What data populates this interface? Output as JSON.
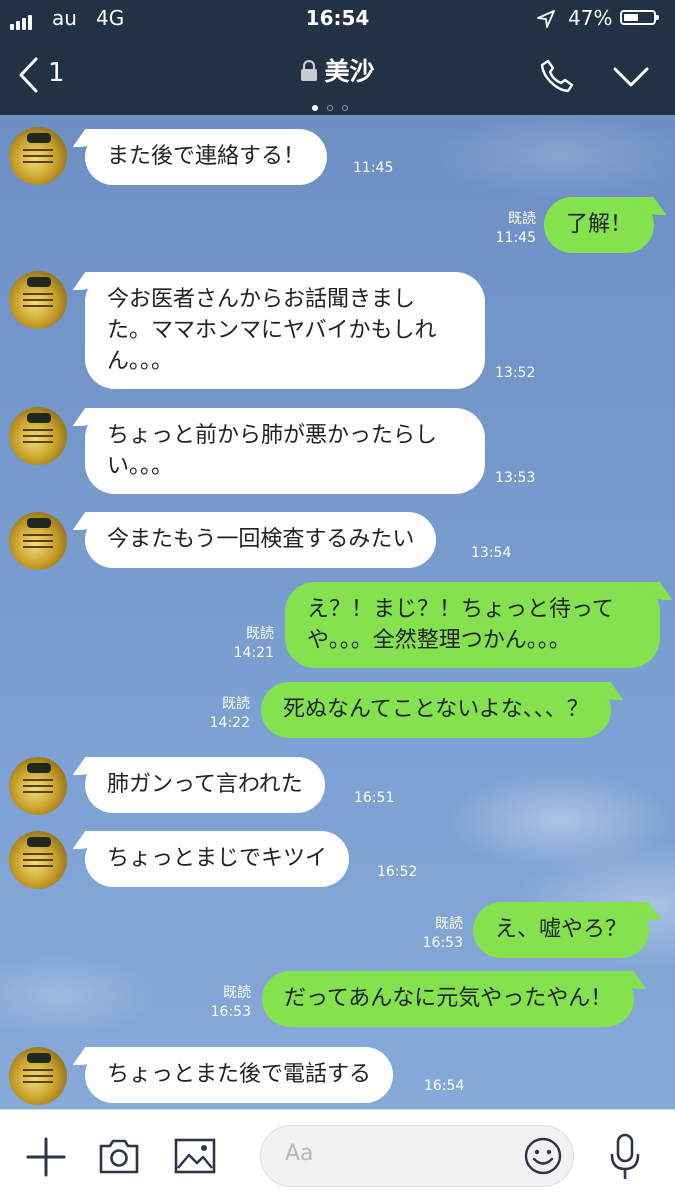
{
  "status_bar": {
    "carrier": "au",
    "network": "4G",
    "time": "16:54",
    "battery": "47%"
  },
  "header": {
    "back_count": "1",
    "title": "美沙",
    "page_dots": 3,
    "active_dot": 0
  },
  "chat": {
    "messages": [
      {
        "side": "in",
        "lines": [
          "また後で連絡する！"
        ],
        "time": "11:45"
      },
      {
        "side": "out",
        "lines": [
          "了解！"
        ],
        "read": "既読",
        "time": "11:45"
      },
      {
        "side": "in",
        "lines": [
          "今お医者さんからお話聞きまし",
          "た。ママホンマにヤバイかもしれ",
          "ん。。。"
        ],
        "time": "13:52"
      },
      {
        "side": "in",
        "lines": [
          "ちょっと前から肺が悪かったらし",
          "い。。。"
        ],
        "time": "13:53"
      },
      {
        "side": "in",
        "lines": [
          "今またもう一回検査するみたい"
        ],
        "time": "13:54"
      },
      {
        "side": "out",
        "lines": [
          "え？！まじ？！ちょっと待って",
          "や。。。全然整理つかん。。。"
        ],
        "read": "既読",
        "time": "14:21"
      },
      {
        "side": "out",
        "lines": [
          "死ぬなんてことないよな、、、？"
        ],
        "read": "既読",
        "time": "14:22"
      },
      {
        "side": "in",
        "lines": [
          "肺ガンって言われた"
        ],
        "time": "16:51"
      },
      {
        "side": "in",
        "lines": [
          "ちょっとまじでキツイ"
        ],
        "time": "16:52"
      },
      {
        "side": "out",
        "lines": [
          "え、嘘やろ？"
        ],
        "read": "既読",
        "time": "16:53"
      },
      {
        "side": "out",
        "lines": [
          "だってあんなに元気やったやん！"
        ],
        "read": "既読",
        "time": "16:53"
      },
      {
        "side": "in",
        "lines": [
          "ちょっとまた後で電話する"
        ],
        "time": "16:54"
      }
    ]
  },
  "footer": {
    "input_placeholder": "Aa"
  },
  "colors": {
    "header_bg": "#233145",
    "outgoing_bubble": "#83e24e",
    "incoming_bubble": "#ffffff",
    "chat_bg": "#7796c7"
  },
  "icons": {
    "header": [
      "back-chevron-icon",
      "lock-icon",
      "phone-icon",
      "chevron-down-icon"
    ],
    "footer": [
      "plus-icon",
      "camera-icon",
      "image-icon",
      "emoji-icon",
      "microphone-icon"
    ]
  }
}
